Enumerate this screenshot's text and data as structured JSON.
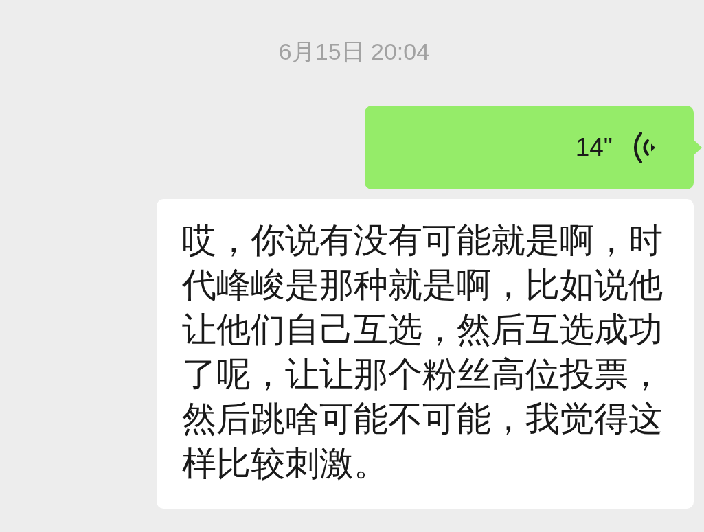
{
  "timestamp": "6月15日 20:04",
  "voice_message": {
    "duration": "14\"",
    "transcription": "哎，你说有没有可能就是啊，时代峰峻是那种就是啊，比如说他让他们自己互选，然后互选成功了呢，让让那个粉丝高位投票，然后跳啥可能不可能，我觉得这样比较刺激。"
  }
}
